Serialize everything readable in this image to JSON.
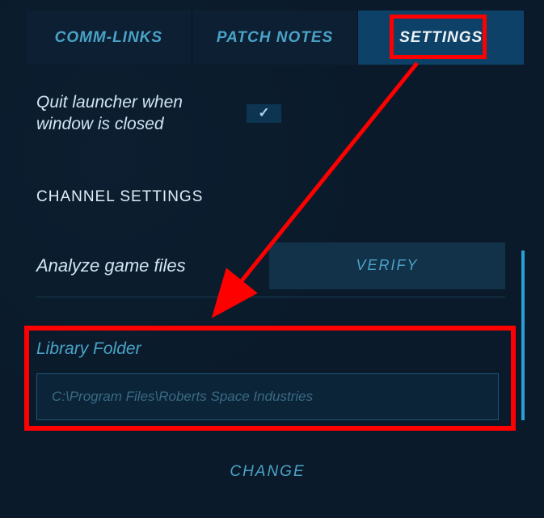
{
  "tabs": {
    "comm_links": "COMM-LINKS",
    "patch_notes": "PATCH NOTES",
    "settings": "SETTINGS"
  },
  "settings": {
    "quit_label": "Quit launcher when window is closed",
    "quit_checked": true,
    "section_title": "CHANNEL SETTINGS",
    "analyze_label": "Analyze game files",
    "verify_button": "VERIFY",
    "library_label": "Library Folder",
    "library_path": "C:\\Program Files\\Roberts Space Industries",
    "change_button": "CHANGE"
  }
}
